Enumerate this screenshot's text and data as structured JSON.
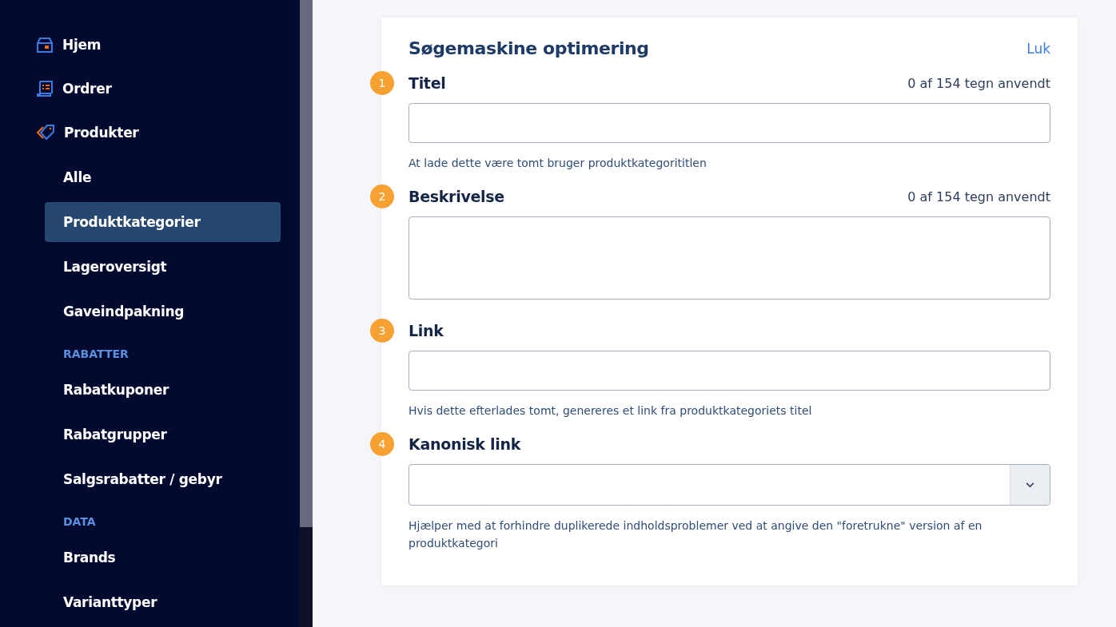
{
  "sidebar": {
    "items": [
      {
        "kind": "main",
        "label": "Hjem",
        "selected": false
      },
      {
        "kind": "main",
        "label": "Ordrer",
        "selected": false
      },
      {
        "kind": "main",
        "label": "Produkter",
        "selected": false
      },
      {
        "kind": "sub",
        "label": "Alle",
        "selected": false
      },
      {
        "kind": "sub",
        "label": "Produktkategorier",
        "selected": true
      },
      {
        "kind": "sub",
        "label": "Lageroversigt",
        "selected": false
      },
      {
        "kind": "sub",
        "label": "Gaveindpakning",
        "selected": false
      },
      {
        "kind": "section",
        "label": "RABATTER"
      },
      {
        "kind": "sub",
        "label": "Rabatkuponer",
        "selected": false
      },
      {
        "kind": "sub",
        "label": "Rabatgrupper",
        "selected": false
      },
      {
        "kind": "sub",
        "label": "Salgsrabatter / gebyr",
        "selected": false
      },
      {
        "kind": "section",
        "label": "DATA"
      },
      {
        "kind": "sub",
        "label": "Brands",
        "selected": false
      },
      {
        "kind": "sub",
        "label": "Varianttyper",
        "selected": false
      }
    ]
  },
  "panel": {
    "title": "Søgemaskine optimering",
    "close_link": "Luk",
    "fields": [
      {
        "step": "1",
        "label": "Titel",
        "counter": "0 af 154 tegn anvendt",
        "kind": "text",
        "help": "At lade dette være tomt bruger produktkategorititlen"
      },
      {
        "step": "2",
        "label": "Beskrivelse",
        "counter": "0 af 154 tegn anvendt",
        "kind": "textarea"
      },
      {
        "step": "3",
        "label": "Link",
        "kind": "text",
        "help": "Hvis dette efterlades tomt, genereres et link fra produktkategoriets titel"
      },
      {
        "step": "4",
        "label": "Kanonisk link",
        "kind": "select",
        "help": "Hjælper med at forhindre duplikerede indholdsproblemer ved at angive den \"foretrukne\" version af en produktkategori"
      }
    ]
  }
}
